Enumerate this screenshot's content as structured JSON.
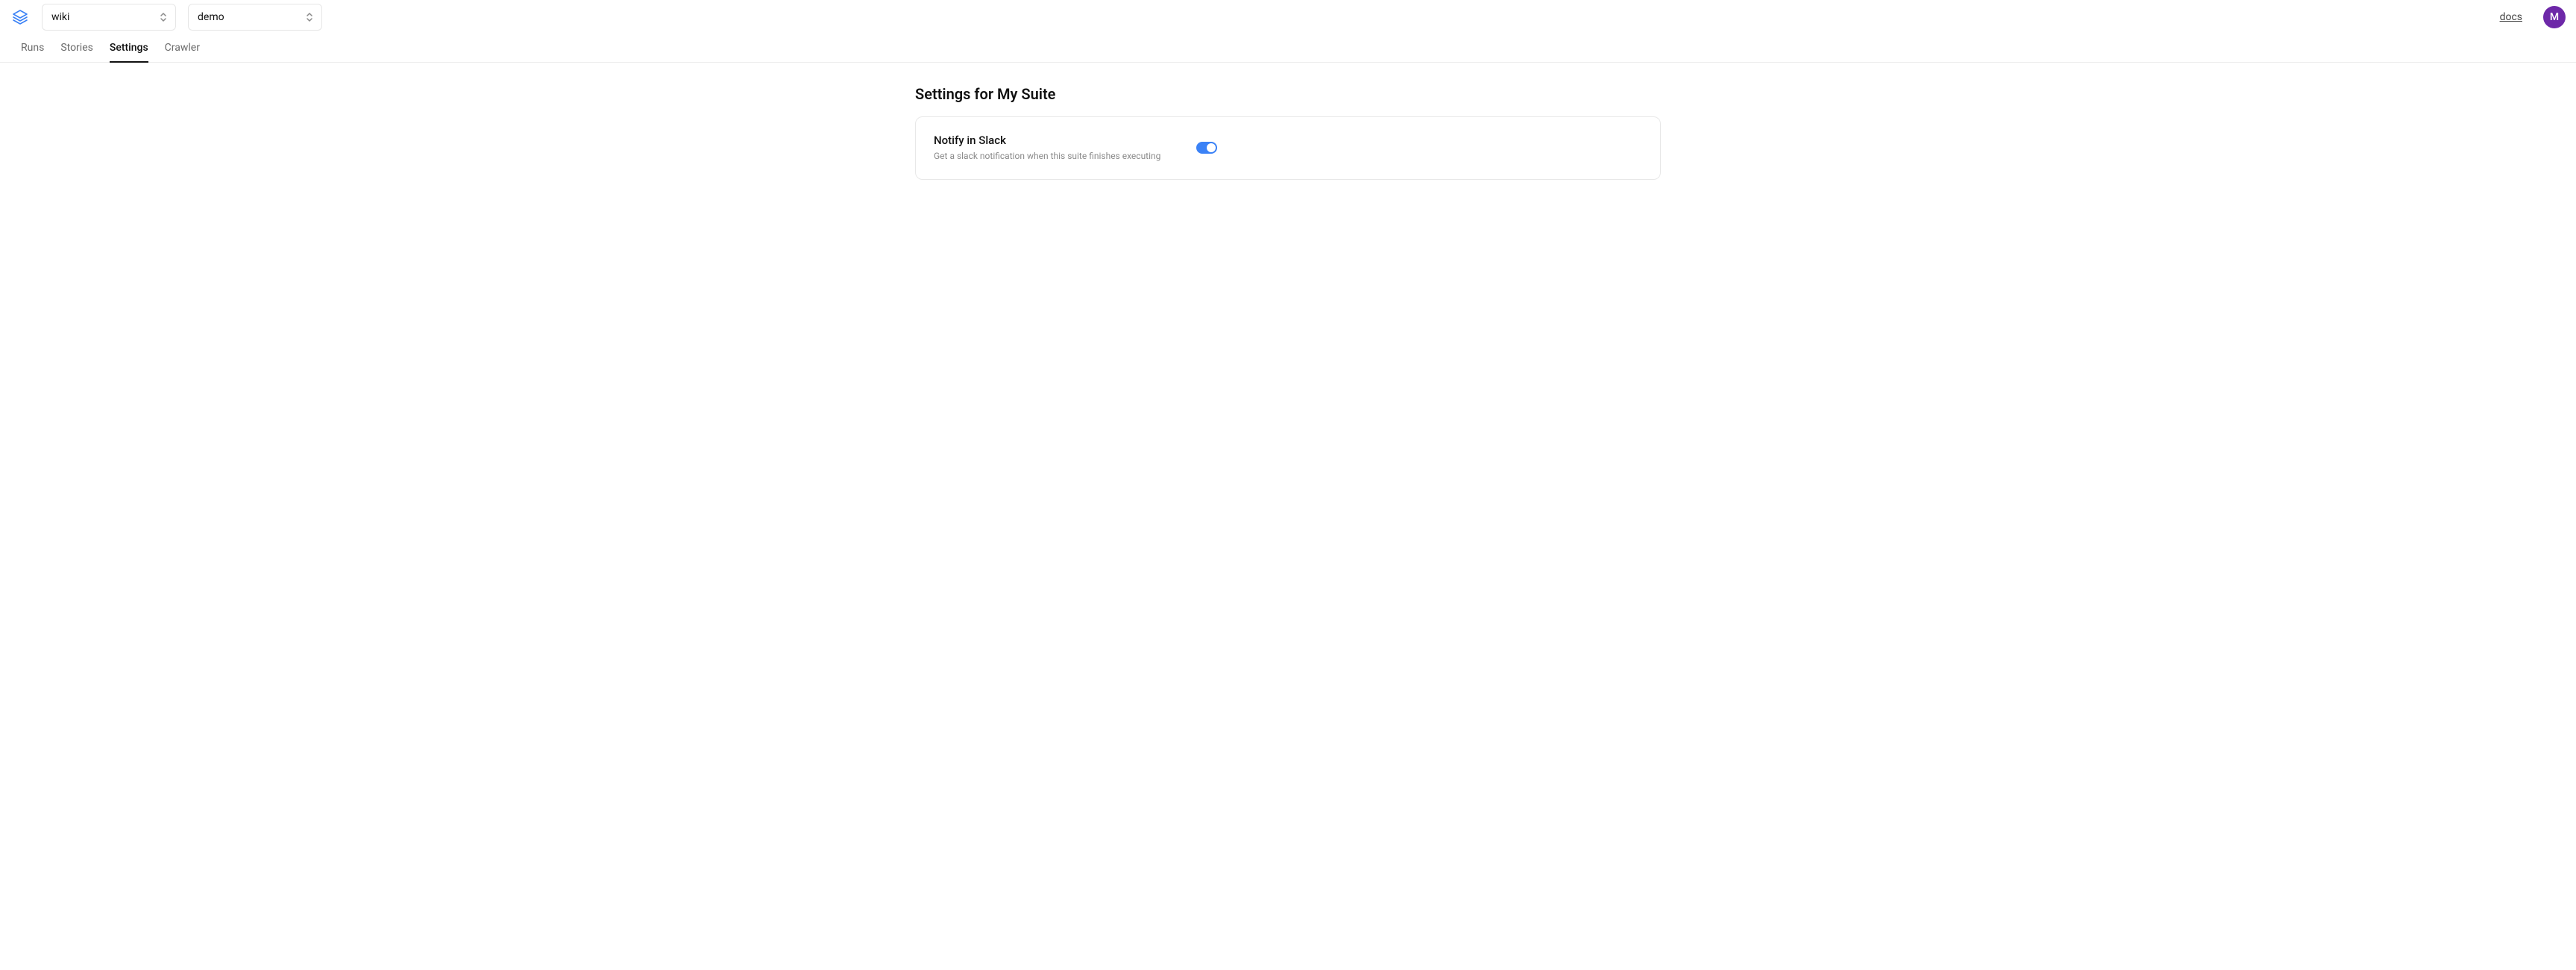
{
  "header": {
    "select_project": "wiki",
    "select_suite": "demo",
    "docs_label": "docs",
    "avatar_initial": "M"
  },
  "tabs": [
    {
      "id": "runs",
      "label": "Runs",
      "active": false
    },
    {
      "id": "stories",
      "label": "Stories",
      "active": false
    },
    {
      "id": "settings",
      "label": "Settings",
      "active": true
    },
    {
      "id": "crawler",
      "label": "Crawler",
      "active": false
    }
  ],
  "page": {
    "title": "Settings for My Suite"
  },
  "settings": {
    "notify_slack": {
      "title": "Notify in Slack",
      "description": "Get a slack notification when this suite finishes executing",
      "enabled": true
    }
  },
  "colors": {
    "accent_blue": "#3b82f6",
    "avatar_purple": "#6d28a8",
    "text_muted": "#8a8a8a",
    "border": "#e8e8e8"
  }
}
